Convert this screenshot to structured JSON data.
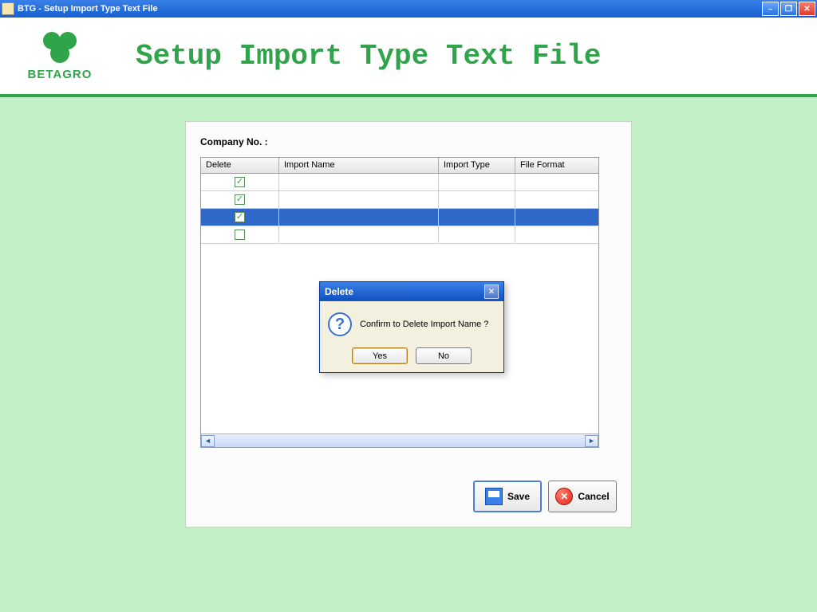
{
  "window": {
    "title": "BTG - Setup Import Type Text File"
  },
  "header": {
    "logo_text": "BETAGRO",
    "page_title": "Setup Import Type Text File"
  },
  "panel": {
    "company_label": "Company No. :",
    "company_value": ""
  },
  "grid": {
    "headers": {
      "delete": "Delete",
      "import_name": "Import Name",
      "import_type": "Import Type",
      "file_format": "File Format"
    },
    "rows": [
      {
        "checked": true,
        "selected": false,
        "import_name": "",
        "import_type": "",
        "file_format": ""
      },
      {
        "checked": true,
        "selected": false,
        "import_name": "",
        "import_type": "",
        "file_format": ""
      },
      {
        "checked": true,
        "selected": true,
        "import_name": "",
        "import_type": "",
        "file_format": ""
      },
      {
        "checked": false,
        "selected": false,
        "import_name": "",
        "import_type": "",
        "file_format": ""
      }
    ]
  },
  "actions": {
    "save": "Save",
    "cancel": "Cancel"
  },
  "dialog": {
    "title": "Delete",
    "message": "Confirm to Delete Import Name ?",
    "yes": "Yes",
    "no": "No"
  }
}
